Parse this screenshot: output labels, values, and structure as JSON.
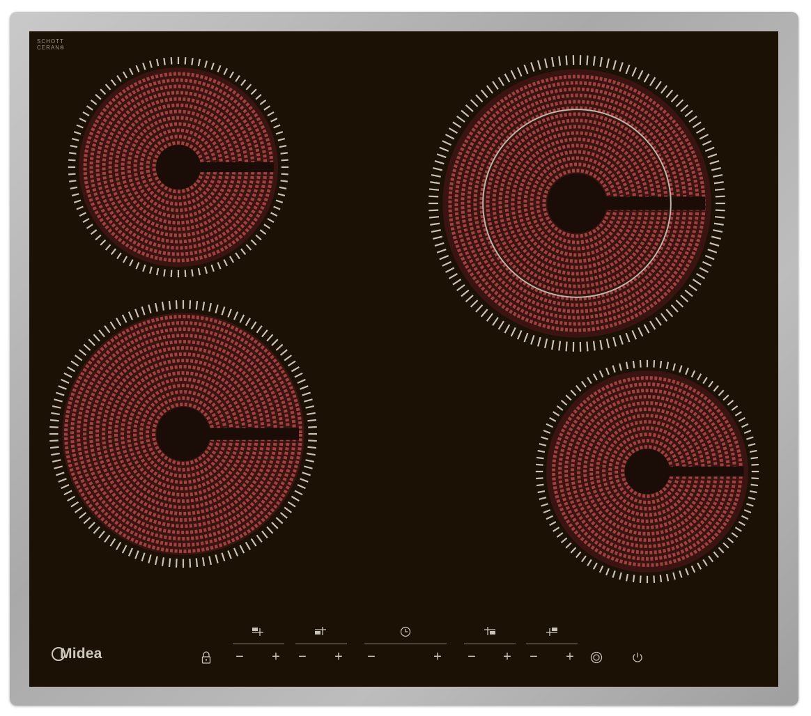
{
  "panel": {
    "certification": [
      "SCHOTT",
      "CERAN®"
    ],
    "brand": "Midea"
  },
  "zones": [
    {
      "name": "front-left",
      "rings": 1
    },
    {
      "name": "rear-left",
      "rings": 1
    },
    {
      "name": "rear-right",
      "rings": 2
    },
    {
      "name": "front-right",
      "rings": 1
    }
  ],
  "controls": {
    "minus_label": "−",
    "plus_label": "+"
  },
  "colors": {
    "glass": "#1b1105",
    "coil": "#b14a4a",
    "frame": "#b3b3b3",
    "marker": "#c9c2b6"
  }
}
